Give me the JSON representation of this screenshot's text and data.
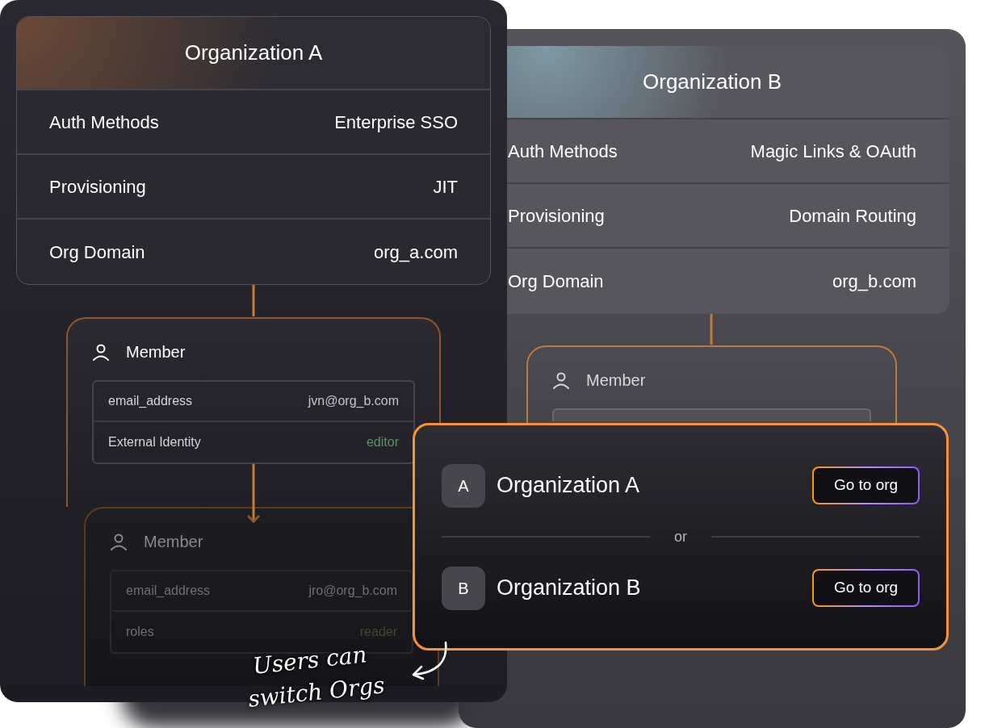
{
  "organizations": [
    {
      "title": "Organization A",
      "settings": [
        {
          "label": "Auth Methods",
          "value": "Enterprise SSO"
        },
        {
          "label": "Provisioning",
          "value": "JIT"
        },
        {
          "label": "Org Domain",
          "value": "org_a.com"
        }
      ],
      "members": [
        {
          "title": "Member",
          "faded": false,
          "fields": [
            {
              "label": "email_address",
              "value": "jvn@org_b.com",
              "kind": "plain"
            },
            {
              "label": "External Identity",
              "value": "editor",
              "kind": "role"
            }
          ]
        },
        {
          "title": "Member",
          "faded": true,
          "fields": [
            {
              "label": "email_address",
              "value": "jro@org_b.com",
              "kind": "plain"
            },
            {
              "label": "roles",
              "value": "reader",
              "kind": "role"
            }
          ]
        }
      ]
    },
    {
      "title": "Organization B",
      "settings": [
        {
          "label": "Auth Methods",
          "value": "Magic Links & OAuth"
        },
        {
          "label": "Provisioning",
          "value": "Domain Routing"
        },
        {
          "label": "Org Domain",
          "value": "org_b.com"
        }
      ],
      "members": [
        {
          "title": "Member",
          "faded": false
        }
      ]
    }
  ],
  "switcher": {
    "options": [
      {
        "badge": "A",
        "name": "Organization A",
        "button": "Go to org"
      },
      {
        "badge": "B",
        "name": "Organization B",
        "button": "Go to org"
      }
    ],
    "separator": "or"
  },
  "annotation": [
    "Users can",
    "switch Orgs"
  ]
}
